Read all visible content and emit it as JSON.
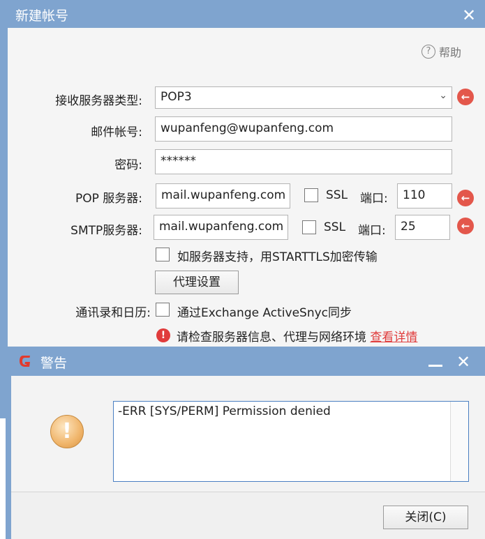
{
  "dialog": {
    "title": "新建帐号",
    "help_label": "帮助",
    "help_icon": "question-circle-icon",
    "receive_type": {
      "label": "接收服务器类型:",
      "value": "POP3"
    },
    "account": {
      "label": "邮件帐号:",
      "value": "wupanfeng@wupanfeng.com"
    },
    "password": {
      "label": "密码:",
      "value": "******"
    },
    "pop": {
      "label": "POP 服务器:",
      "value": "mail.wupanfeng.com",
      "ssl_label": "SSL",
      "port_label": "端口:",
      "port": "110"
    },
    "smtp": {
      "label": "SMTP服务器:",
      "value": "mail.wupanfeng.com",
      "ssl_label": "SSL",
      "port_label": "端口:",
      "port": "25"
    },
    "starttls_label": "如服务器支持，用STARTTLS加密传输",
    "proxy_button": "代理设置",
    "contacts_label": "通讯录和日历:",
    "activesync_label": "通过Exchange ActiveSnyc同步",
    "error_text": "请检查服务器信息、代理与网络环境",
    "error_link": "查看详情",
    "arrow_color": "#e3574b",
    "error_color": "#e03b3b"
  },
  "alert": {
    "title": "警告",
    "message": "-ERR [SYS/PERM] Permission denied",
    "close_button": "关闭(C)",
    "title_bar_color": "#7fa4cf"
  }
}
